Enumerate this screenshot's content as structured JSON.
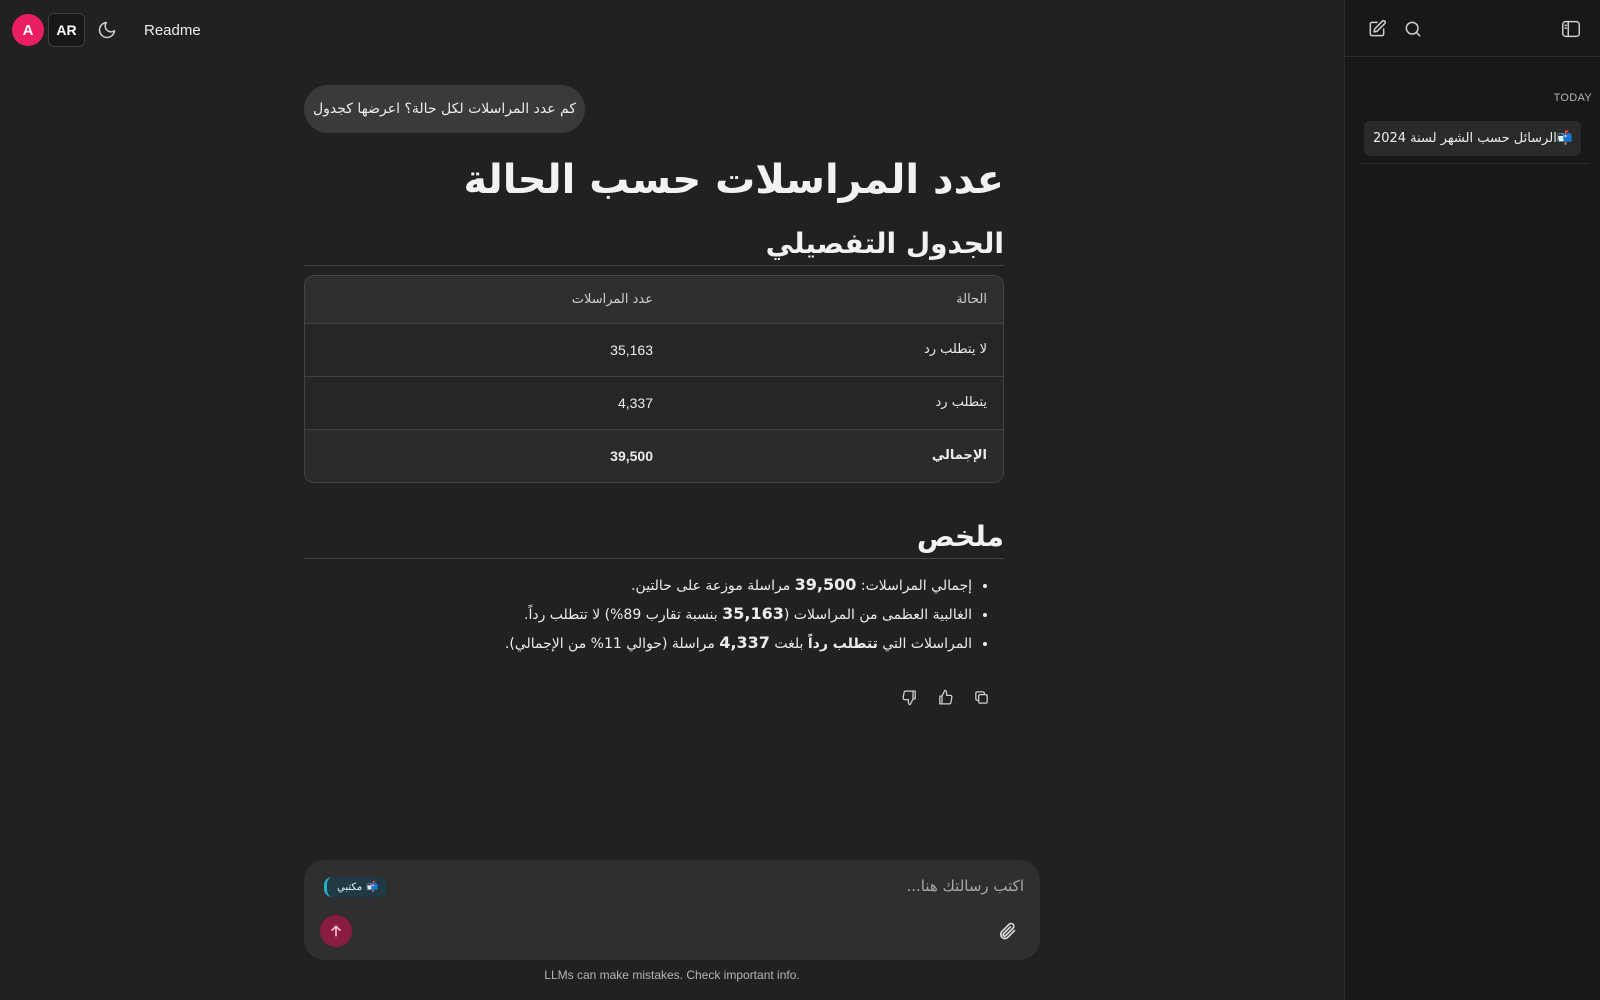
{
  "header": {
    "avatar_letter": "A",
    "lang_label": "AR",
    "readme_label": "Readme",
    "theme_icon": "moon-icon"
  },
  "sidebar": {
    "icons": [
      "edit-icon",
      "search-icon",
      "sidebar-toggle-icon"
    ],
    "section_label": "TODAY",
    "items": [
      {
        "label": "📬الرسائل حسب الشهر لسنة 2024"
      }
    ]
  },
  "conversation": {
    "user_message": "كم عدد المراسلات لكل حالة؟ اعرضها كجدول",
    "answer": {
      "title": "عدد المراسلات حسب الحالة",
      "table_heading": "الجدول التفصيلي",
      "table": {
        "headers": [
          "الحالة",
          "عدد المراسلات"
        ],
        "rows": [
          [
            "لا يتطلب رد",
            "35,163"
          ],
          [
            "يتطلب رد",
            "4,337"
          ],
          [
            "الإجمالي",
            "39,500"
          ]
        ]
      },
      "summary_heading": "ملخص",
      "summary": [
        {
          "before": "إجمالي المراسلات: ",
          "bold": "39,500",
          "after": " مراسلة موزعة على حالتين."
        },
        {
          "before": "الغالبية العظمى من المراسلات (",
          "bold": "35,163",
          "after": " بنسبة تقارب 89%) لا تتطلب رداً."
        },
        {
          "before": "المراسلات التي ",
          "bold": "تتطلب رداً",
          "middle": " بلغت ",
          "bold2": "4,337",
          "after": " مراسلة (حوالي 11% من الإجمالي)."
        }
      ],
      "action_icons": [
        "copy-icon",
        "thumbs-up-icon",
        "thumbs-down-icon"
      ]
    }
  },
  "composer": {
    "placeholder": "اكتب رسالتك هنا...",
    "chip_label": "مكتبي",
    "chip_emoji": "📬",
    "accent": "#1fb1c9",
    "send_color": "#8a1c3f"
  },
  "footer": {
    "disclaimer": "LLMs can make mistakes. Check important info."
  }
}
